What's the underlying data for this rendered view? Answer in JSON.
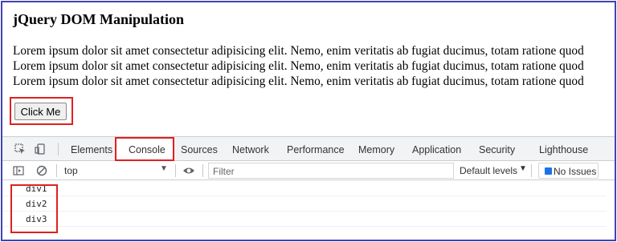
{
  "page": {
    "title": "jQuery DOM Manipulation",
    "paragraphs": [
      "Lorem ipsum dolor sit amet consectetur adipisicing elit. Nemo, enim veritatis ab fugiat ducimus, totam ratione quod",
      "Lorem ipsum dolor sit amet consectetur adipisicing elit. Nemo, enim veritatis ab fugiat ducimus, totam ratione quod",
      "Lorem ipsum dolor sit amet consectetur adipisicing elit. Nemo, enim veritatis ab fugiat ducimus, totam ratione quod"
    ],
    "button_label": "Click Me"
  },
  "devtools": {
    "tabs": [
      "Elements",
      "Console",
      "Sources",
      "Network",
      "Performance",
      "Memory",
      "Application",
      "Security",
      "Lighthouse"
    ],
    "active_tab": "Console",
    "toolbar": {
      "context": "top",
      "filter_placeholder": "Filter",
      "levels_label": "Default levels",
      "issues_label": "No Issues"
    },
    "console_logs": [
      "div1",
      "div2",
      "div3"
    ]
  },
  "colors": {
    "highlight": "#e02020",
    "frame_border": "#3f43b7",
    "issues_icon": "#1a73e8"
  },
  "icons": [
    "inspect-element-icon",
    "device-toolbar-icon",
    "sidebar-toggle-icon",
    "clear-console-icon",
    "eye-icon",
    "dropdown-arrow-icon",
    "info-icon"
  ]
}
